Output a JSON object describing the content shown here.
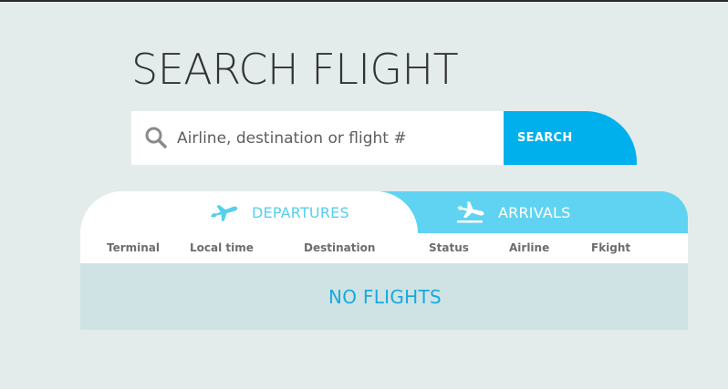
{
  "title": "SEARCH FLIGHT",
  "search": {
    "placeholder": "Airline, destination or flight #",
    "button_label": "SEARCH"
  },
  "tabs": [
    {
      "label": "DEPARTURES",
      "icon": "plane-departure-icon",
      "active": true
    },
    {
      "label": "ARRIVALS",
      "icon": "plane-arrival-icon",
      "active": false
    }
  ],
  "table": {
    "columns": [
      "Terminal",
      "Local time",
      "Destination",
      "Status",
      "Airline",
      "Fkight"
    ],
    "empty_message": "NO FLIGHTS"
  },
  "colors": {
    "background": "#e3ecea",
    "accent": "#00b0ed",
    "tab_inactive": "#5fd3f1",
    "tab_active_text": "#56cfed",
    "table_body": "#cfe3e4"
  }
}
